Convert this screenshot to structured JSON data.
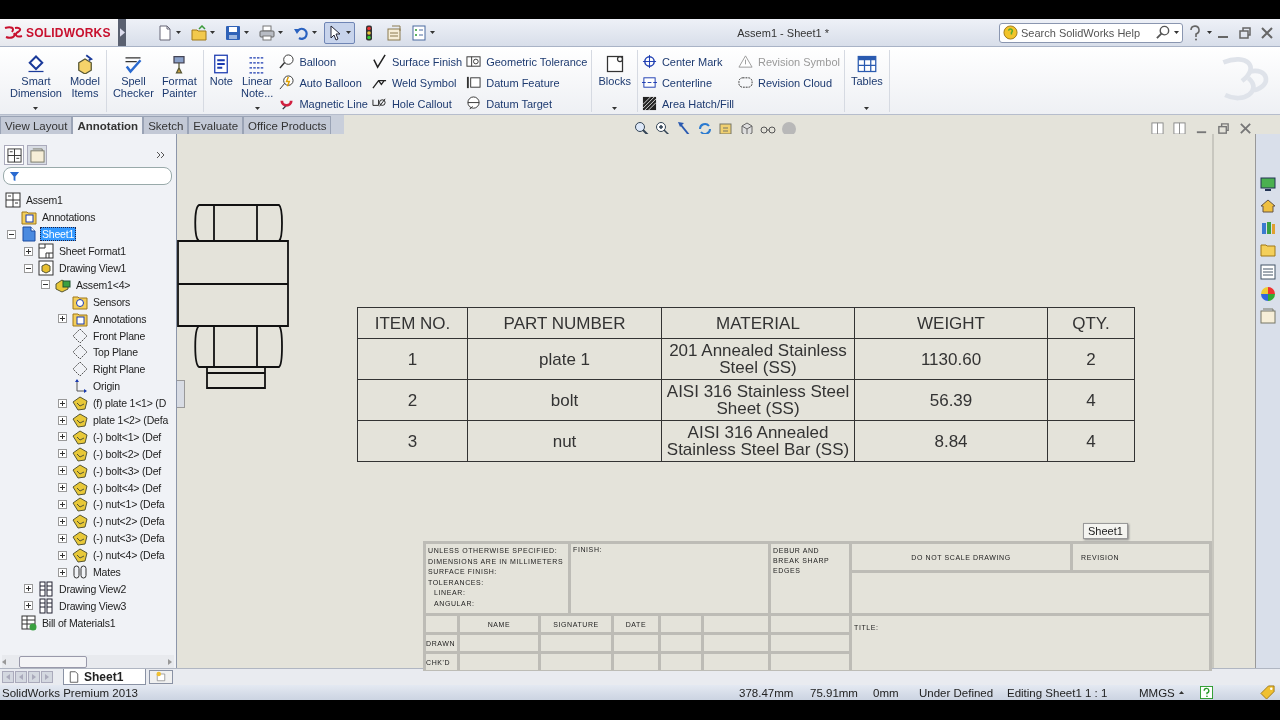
{
  "window": {
    "app_name": "SOLIDWORKS",
    "title": "Assem1 - Sheet1 *",
    "search": {
      "placeholder": "Search SolidWorks Help"
    }
  },
  "quick_access": [
    {
      "selected": false,
      "dropdown": true
    },
    {
      "selected": false,
      "dropdown": true
    },
    {
      "selected": false,
      "dropdown": true
    },
    {
      "selected": false,
      "dropdown": true
    },
    {
      "selected": false,
      "dropdown": true
    },
    {
      "selected": true,
      "dropdown": true
    },
    {
      "selected": false,
      "dropdown": false
    },
    {
      "selected": false,
      "dropdown": false
    },
    {
      "selected": false,
      "dropdown": true
    }
  ],
  "ribbon": {
    "groups": [
      [
        {
          "kind": "large",
          "label": "Smart Dimension",
          "dropdown": true
        },
        {
          "kind": "large",
          "label": "Model Items",
          "dropdown": false
        }
      ],
      [
        {
          "kind": "large",
          "label": "Spell Checker",
          "dropdown": false
        },
        {
          "kind": "large",
          "label": "Format Painter",
          "dropdown": false
        }
      ],
      [
        {
          "kind": "large",
          "label": "Note",
          "dropdown": false
        },
        {
          "kind": "large",
          "label": "Linear Note...",
          "dropdown": true
        },
        {
          "kind": "stack",
          "tools": [
            {
              "label": "Balloon",
              "disabled": false
            },
            {
              "label": "Auto Balloon",
              "disabled": false
            },
            {
              "label": "Magnetic Line",
              "disabled": false
            }
          ]
        },
        {
          "kind": "stack",
          "tools": [
            {
              "label": "Surface Finish",
              "disabled": false
            },
            {
              "label": "Weld Symbol",
              "disabled": false
            },
            {
              "label": "Hole Callout",
              "disabled": false
            }
          ]
        },
        {
          "kind": "stack",
          "tools": [
            {
              "label": "Geometric Tolerance",
              "disabled": false
            },
            {
              "label": "Datum Feature",
              "disabled": false
            },
            {
              "label": "Datum Target",
              "disabled": false
            }
          ]
        }
      ],
      [
        {
          "kind": "large",
          "label": "Blocks",
          "dropdown": true
        }
      ],
      [
        {
          "kind": "stack",
          "tools": [
            {
              "label": "Center Mark",
              "disabled": false
            },
            {
              "label": "Centerline",
              "disabled": false
            },
            {
              "label": "Area Hatch/Fill",
              "disabled": false
            }
          ]
        },
        {
          "kind": "stack",
          "tools": [
            {
              "label": "Revision Symbol",
              "disabled": true
            },
            {
              "label": "Revision Cloud",
              "disabled": false
            }
          ]
        }
      ],
      [
        {
          "kind": "large",
          "label": "Tables",
          "dropdown": true
        }
      ]
    ]
  },
  "tabs": [
    {
      "label": "View Layout",
      "selected": false
    },
    {
      "label": "Annotation",
      "selected": true
    },
    {
      "label": "Sketch",
      "selected": false
    },
    {
      "label": "Evaluate",
      "selected": false
    },
    {
      "label": "Office Products",
      "selected": false
    }
  ],
  "panel_tabs": [
    {
      "selected": true
    },
    {
      "selected": false
    }
  ],
  "tree": [
    {
      "label": "Assem1",
      "kind": "drawing",
      "selected": false,
      "children": [
        {
          "label": "Annotations",
          "kind": "annotations",
          "selected": false
        },
        {
          "label": "Sheet1",
          "kind": "sheet",
          "selected": true,
          "expanded": true,
          "children": [
            {
              "label": "Sheet Format1",
              "kind": "sheet-format",
              "selected": false,
              "expanded": false
            },
            {
              "label": "Drawing View1",
              "kind": "view-model",
              "selected": false,
              "expanded": true,
              "children": [
                {
                  "label": "Assem1<4>",
                  "kind": "assembly",
                  "selected": false,
                  "expanded": true,
                  "children": [
                    {
                      "label": "Sensors",
                      "kind": "sensors",
                      "selected": false
                    },
                    {
                      "label": "Annotations",
                      "kind": "annotations",
                      "selected": false,
                      "expanded": false
                    },
                    {
                      "label": "Front Plane",
                      "kind": "plane",
                      "selected": false
                    },
                    {
                      "label": "Top Plane",
                      "kind": "plane",
                      "selected": false
                    },
                    {
                      "label": "Right Plane",
                      "kind": "plane",
                      "selected": false
                    },
                    {
                      "label": "Origin",
                      "kind": "origin",
                      "selected": false
                    },
                    {
                      "label": "(f) plate 1<1> (D",
                      "kind": "part",
                      "selected": false,
                      "expanded": false
                    },
                    {
                      "label": "plate 1<2> (Defa",
                      "kind": "part",
                      "selected": false,
                      "expanded": false
                    },
                    {
                      "label": "(-) bolt<1> (Def",
                      "kind": "part",
                      "selected": false,
                      "expanded": false
                    },
                    {
                      "label": "(-) bolt<2> (Def",
                      "kind": "part",
                      "selected": false,
                      "expanded": false
                    },
                    {
                      "label": "(-) bolt<3> (Def",
                      "kind": "part",
                      "selected": false,
                      "expanded": false
                    },
                    {
                      "label": "(-) bolt<4> (Def",
                      "kind": "part",
                      "selected": false,
                      "expanded": false
                    },
                    {
                      "label": "(-) nut<1> (Defa",
                      "kind": "part",
                      "selected": false,
                      "expanded": false
                    },
                    {
                      "label": "(-) nut<2> (Defa",
                      "kind": "part",
                      "selected": false,
                      "expanded": false
                    },
                    {
                      "label": "(-) nut<3> (Defa",
                      "kind": "part",
                      "selected": false,
                      "expanded": false
                    },
                    {
                      "label": "(-) nut<4> (Defa",
                      "kind": "part",
                      "selected": false,
                      "expanded": false
                    },
                    {
                      "label": "Mates",
                      "kind": "mates",
                      "selected": false,
                      "expanded": false
                    }
                  ]
                }
              ]
            },
            {
              "label": "Drawing View2",
              "kind": "view-blank",
              "selected": false,
              "expanded": false
            },
            {
              "label": "Drawing View3",
              "kind": "view-blank",
              "selected": false,
              "expanded": false
            }
          ]
        },
        {
          "label": "Bill of Materials1",
          "kind": "bom",
          "selected": false
        }
      ]
    }
  ],
  "bom": {
    "columns": [
      "ITEM NO.",
      "PART NUMBER",
      "MATERIAL",
      "WEIGHT",
      "QTY."
    ],
    "rows": [
      [
        "1",
        "plate 1",
        "201 Annealed Stainless Steel (SS)",
        "1130.60",
        "2"
      ],
      [
        "2",
        "bolt",
        "AISI 316 Stainless Steel Sheet (SS)",
        "56.39",
        "4"
      ],
      [
        "3",
        "nut",
        "AISI 316 Annealed Stainless Steel Bar (SS)",
        "8.84",
        "4"
      ]
    ]
  },
  "title_block": {
    "notes": [
      "UNLESS OTHERWISE SPECIFIED:",
      "DIMENSIONS ARE IN MILLIMETERS",
      "SURFACE FINISH:",
      "TOLERANCES:",
      "LINEAR:",
      "ANGULAR:"
    ],
    "finish": "FINISH:",
    "deburr": "DEBUR AND BREAK SHARP EDGES",
    "no_scale": "DO NOT SCALE DRAWING",
    "revision": "REVISION",
    "signature_columns": [
      "NAME",
      "SIGNATURE",
      "DATE"
    ],
    "signature_rows": [
      "DRAWN",
      "CHK'D"
    ],
    "title": "TITLE:"
  },
  "sheet_tooltip": "Sheet1",
  "sheet_tabs": [
    {
      "label": "Sheet1",
      "selected": true
    }
  ],
  "status_bar": {
    "product": "SolidWorks Premium 2013",
    "x": "378.47mm",
    "y": "75.91mm",
    "z": "0mm",
    "state": "Under Defined",
    "editing": "Editing Sheet1",
    "scale": "1 : 1",
    "units": "MMGS"
  }
}
